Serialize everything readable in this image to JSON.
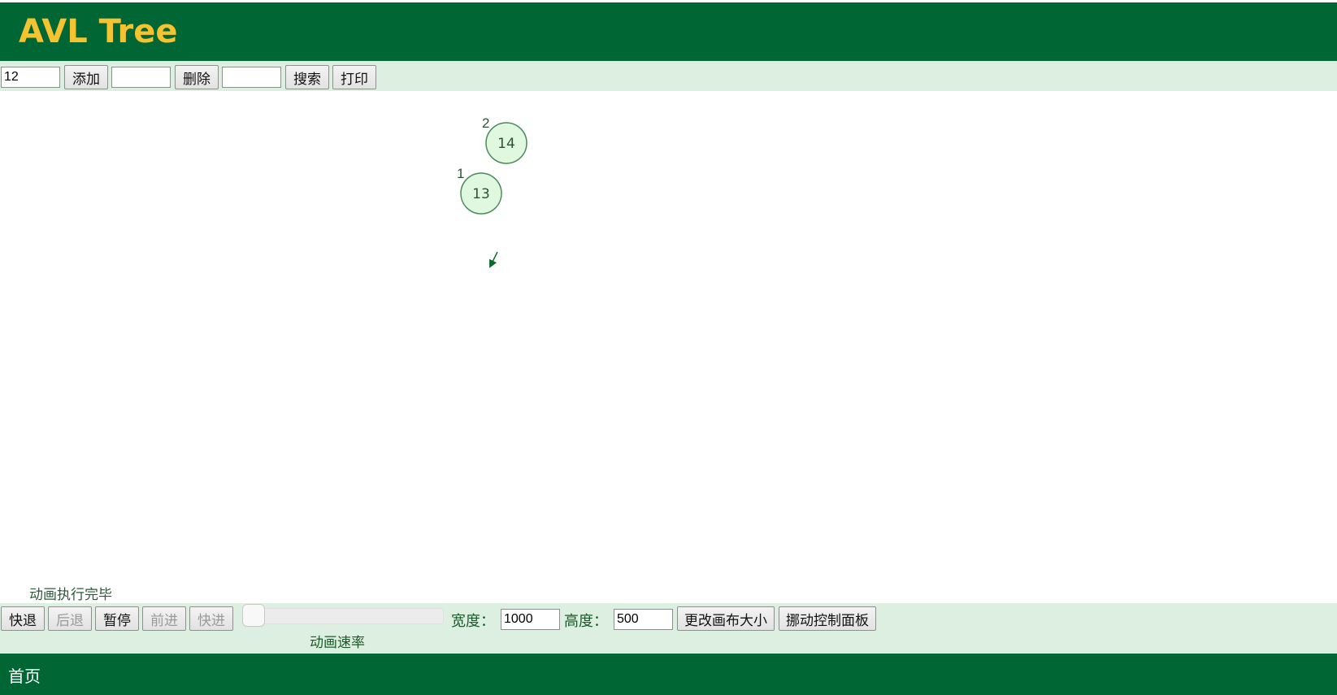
{
  "header": {
    "title": "AVL Tree"
  },
  "toolbar": {
    "add_input_value": "12",
    "add_label": "添加",
    "delete_input_value": "",
    "delete_label": "删除",
    "search_input_value": "",
    "search_label": "搜索",
    "print_label": "打印"
  },
  "tree": {
    "nodes": [
      {
        "value": "14",
        "height_label": "2"
      },
      {
        "value": "13",
        "height_label": "1"
      }
    ],
    "edges": [
      {
        "from": "14",
        "to": "13"
      }
    ],
    "colors": {
      "node_fill": "#dff8df",
      "node_stroke": "#4d8a5a",
      "text": "#2b5335",
      "edge": "#0b6a2b"
    }
  },
  "animation": {
    "status": "动画执行完毕",
    "buttons": {
      "skip_back": "快退",
      "step_back": "后退",
      "pause": "暂停",
      "step_forward": "前进",
      "skip_forward": "快进"
    },
    "speed_label": "动画速率"
  },
  "canvas_size": {
    "width_label": "宽度：",
    "width_value": "1000",
    "height_label": "高度：",
    "height_value": "500",
    "resize_label": "更改画布大小",
    "move_panel_label": "挪动控制面板"
  },
  "footer": {
    "home_label": "首页"
  },
  "colors": {
    "header_bg": "#006633",
    "title": "#f5c330",
    "panel_bg": "#ddefe0"
  }
}
